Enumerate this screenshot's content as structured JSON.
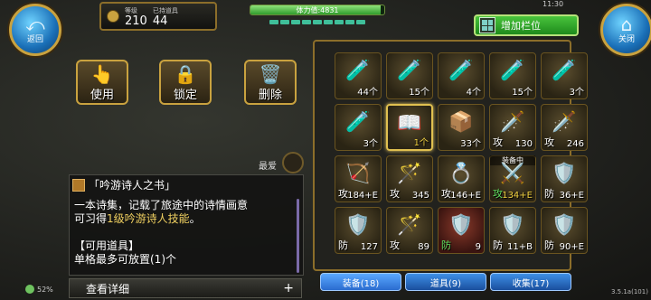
{
  "header": {
    "back_label": "返回",
    "close_label": "关闭",
    "level_caption": "等级",
    "level_value": "210",
    "items_caption": "已持道具",
    "items_value": "44",
    "stamina_text": "体力值:4831",
    "stamina_fill_fraction": 0.97,
    "clock": "11:30",
    "add_slot_label": "增加栏位"
  },
  "actions": {
    "use_label": "使用",
    "lock_label": "锁定",
    "delete_label": "删除"
  },
  "favorite_label": "最爱",
  "description": {
    "title": "「吟游诗人之书」",
    "line1": "一本诗集，记载了旅途中的诗情画意",
    "line2_prefix": "可习得",
    "line2_highlight": "1级吟游诗人技能",
    "line2_suffix": "。",
    "section": "【可用道具】",
    "limit": "单格最多可放置(1)个",
    "details_label": "查看详细",
    "details_plus": "+"
  },
  "battery": "52%",
  "slots": [
    {
      "icon": "🧪",
      "qty": "44个"
    },
    {
      "icon": "🧪",
      "qty": "15个"
    },
    {
      "icon": "🧪",
      "qty": "4个"
    },
    {
      "icon": "🧪",
      "qty": "15个"
    },
    {
      "icon": "🧪",
      "qty": "3个"
    },
    {
      "icon": "🧪",
      "qty": "3个"
    },
    {
      "icon": "📖",
      "qty": "1个"
    },
    {
      "icon": "📦",
      "qty": "33个"
    },
    {
      "icon": "🗡️",
      "type": "攻",
      "qty": "130"
    },
    {
      "icon": "🗡️",
      "type": "攻",
      "qty": "246"
    },
    {
      "icon": "🏹",
      "type": "攻",
      "qty": "184+E"
    },
    {
      "icon": "🪄",
      "type": "攻",
      "qty": "345"
    },
    {
      "icon": "💍",
      "type": "攻",
      "qty": "146+E"
    },
    {
      "equip": "装备中",
      "icon": "⚔️",
      "type": "攻",
      "qty": "134+E"
    },
    {
      "icon": "🛡️",
      "type": "防",
      "qty": "36+E"
    },
    {
      "icon": "🛡️",
      "type": "防",
      "qty": "127"
    },
    {
      "icon": "🪄",
      "type": "攻",
      "qty": "89"
    },
    {
      "icon": "🛡️",
      "type": "防",
      "qty": "9"
    },
    {
      "icon": "🛡️",
      "type": "防",
      "qty": "11+B"
    },
    {
      "icon": "🛡️",
      "type": "防",
      "qty": "90+E"
    }
  ],
  "tabs": [
    {
      "label": "装备(18)"
    },
    {
      "label": "道具(9)"
    },
    {
      "label": "收集(17)"
    }
  ],
  "version": "3.5.1a(101)"
}
